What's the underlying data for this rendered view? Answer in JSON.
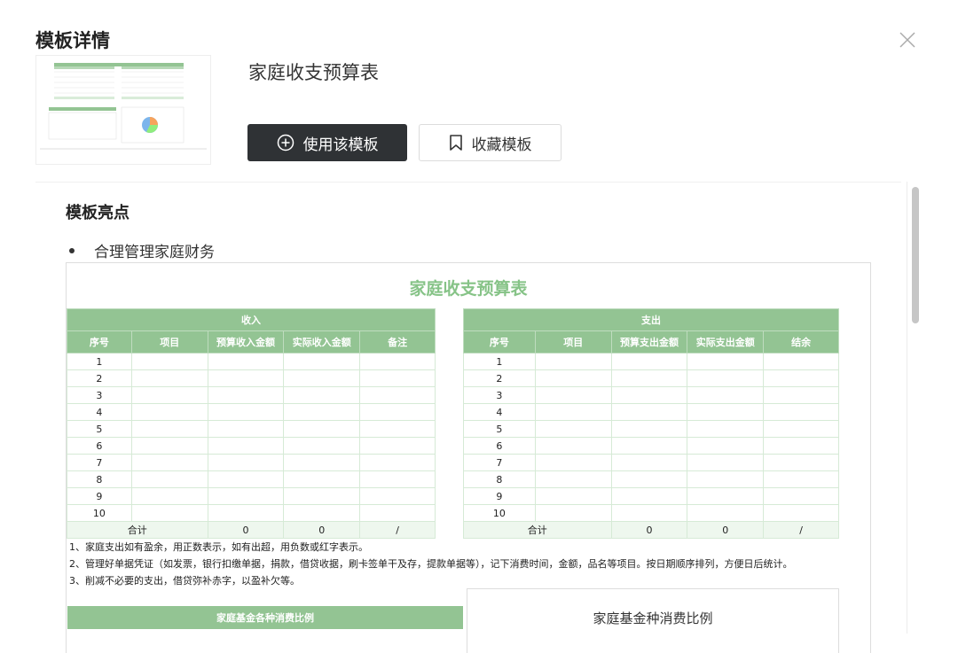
{
  "modal": {
    "title": "模板详情",
    "close_icon": "close-icon"
  },
  "template": {
    "name": "家庭收支预算表"
  },
  "actions": {
    "use_label": "使用该模板",
    "fav_label": "收藏模板"
  },
  "highlights": {
    "title": "模板亮点",
    "items": [
      "合理管理家庭财务"
    ]
  },
  "sheet": {
    "title": "家庭收支预算表",
    "income": {
      "header": "收入",
      "columns": [
        "序号",
        "项目",
        "预算收入金额",
        "实际收入金额",
        "备注"
      ],
      "rows": [
        "1",
        "2",
        "3",
        "4",
        "5",
        "6",
        "7",
        "8",
        "9",
        "10"
      ],
      "total": [
        "合计",
        "0",
        "0",
        "/"
      ]
    },
    "expense": {
      "header": "支出",
      "columns": [
        "序号",
        "项目",
        "预算支出金额",
        "实际支出金额",
        "结余"
      ],
      "rows": [
        "1",
        "2",
        "3",
        "4",
        "5",
        "6",
        "7",
        "8",
        "9",
        "10"
      ],
      "total": [
        "合计",
        "0",
        "0",
        "/"
      ]
    },
    "notes": [
      "1、家庭支出如有盈余，用正数表示，如有出超，用负数或红字表示。",
      "2、管理好单据凭证（如发票，银行扣缴单据，捐款，借贷收据，刷卡签单干及存，提款单据等），记下消费时间，金额，品名等项目。按日期顺序排列，方便日后统计。",
      "3、削减不必要的支出，借贷弥补赤字，以盈补欠等。"
    ],
    "fund_bar_label": "家庭基金各种消费比例",
    "fund_chart_title": "家庭基金种消费比例"
  },
  "colors": {
    "accent_green": "#93c493",
    "title_green": "#86c387",
    "primary_button": "#2f3235"
  }
}
